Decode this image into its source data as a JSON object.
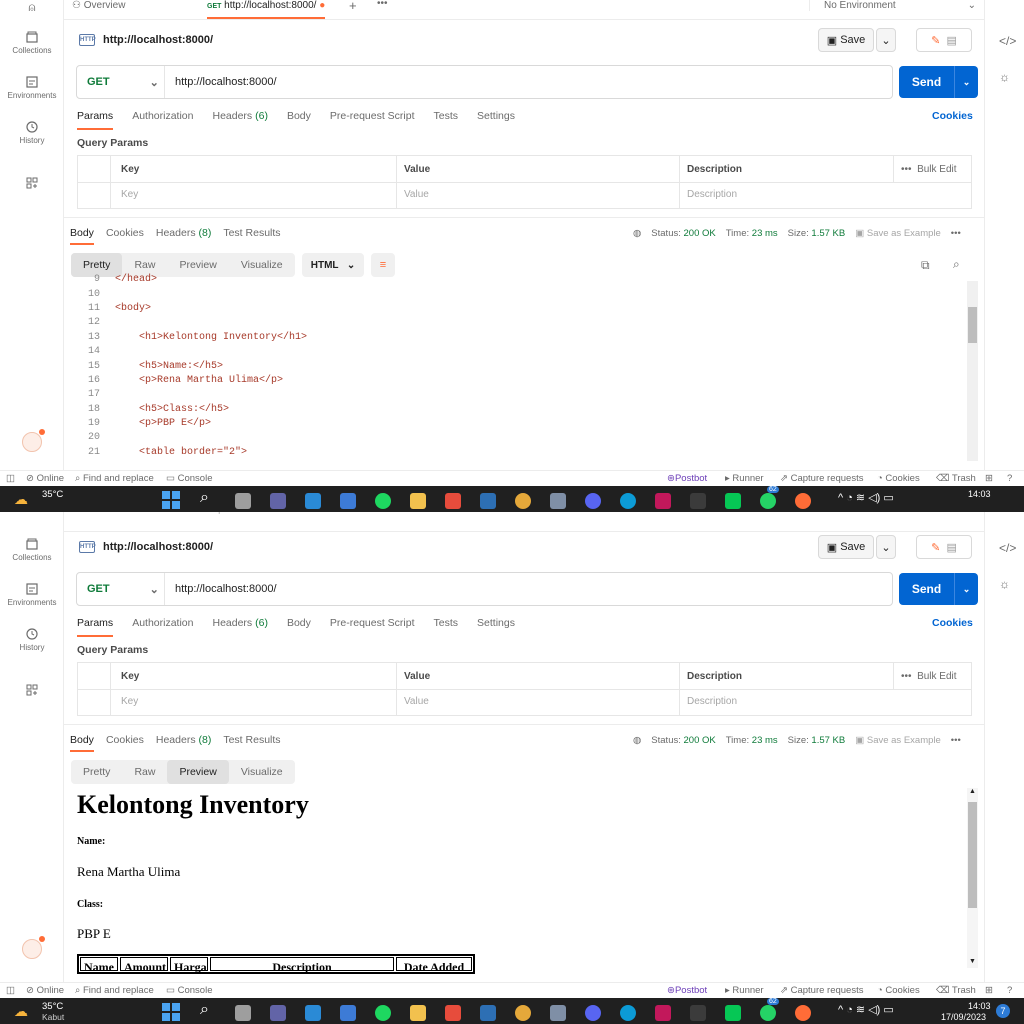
{
  "sidebar": {
    "items": [
      {
        "label": "Collections",
        "icon": "collections-icon"
      },
      {
        "label": "Environments",
        "icon": "environments-icon"
      },
      {
        "label": "History",
        "icon": "history-icon"
      },
      {
        "label": "",
        "icon": "apps-icon"
      }
    ]
  },
  "tabs_bar": {
    "overview": "Overview",
    "tab_method": "GET",
    "tab_url": "http://localhost:8000/",
    "environment": "No Environment"
  },
  "request": {
    "title": "http://localhost:8000/",
    "method": "GET",
    "url": "http://localhost:8000/",
    "save_label": "Save",
    "send_label": "Send"
  },
  "request_tabs": {
    "items": [
      "Params",
      "Authorization",
      "Headers",
      "Body",
      "Pre-request Script",
      "Tests",
      "Settings"
    ],
    "headers_count": "(6)",
    "cookies": "Cookies"
  },
  "query_params": {
    "label": "Query Params",
    "columns": [
      "Key",
      "Value",
      "Description"
    ],
    "placeholders": [
      "Key",
      "Value",
      "Description"
    ],
    "bulk_edit": "Bulk Edit"
  },
  "response": {
    "tabs": [
      "Body",
      "Cookies",
      "Headers",
      "Test Results"
    ],
    "headers_count": "(8)",
    "status_label": "Status:",
    "status_value": "200 OK",
    "time_label": "Time:",
    "time_value": "23 ms",
    "size_label": "Size:",
    "size_value": "1.57 KB",
    "save_example": "Save as Example",
    "view_modes": [
      "Pretty",
      "Raw",
      "Preview",
      "Visualize"
    ],
    "format": "HTML"
  },
  "code_lines": [
    {
      "n": "9",
      "text": "</head>"
    },
    {
      "n": "10",
      "text": ""
    },
    {
      "n": "11",
      "text": "<body>"
    },
    {
      "n": "12",
      "text": ""
    },
    {
      "n": "13",
      "text": "    <h1>Kelontong Inventory</h1>"
    },
    {
      "n": "14",
      "text": ""
    },
    {
      "n": "15",
      "text": "    <h5>Name:</h5>"
    },
    {
      "n": "16",
      "text": "    <p>Rena Martha Ulima</p>"
    },
    {
      "n": "17",
      "text": ""
    },
    {
      "n": "18",
      "text": "    <h5>Class:</h5>"
    },
    {
      "n": "19",
      "text": "    <p>PBP E</p>"
    },
    {
      "n": "20",
      "text": ""
    },
    {
      "n": "21",
      "text": "    <table border=\"2\">"
    }
  ],
  "preview": {
    "h1": "Kelontong Inventory",
    "name_label": "Name:",
    "name_value": "Rena Martha Ulima",
    "class_label": "Class:",
    "class_value": "PBP E",
    "table_headers": [
      "Name",
      "Amount",
      "Harga",
      "Description",
      "Date Added"
    ]
  },
  "statusbar": {
    "online": "Online",
    "find_replace": "Find and replace",
    "console": "Console",
    "postbot": "Postbot",
    "runner": "Runner",
    "capture": "Capture requests",
    "cookies": "Cookies",
    "trash": "Trash"
  },
  "taskbar": {
    "temp": "35°C",
    "weather": "Kabut",
    "time": "14:03",
    "date": "17/09/2023",
    "badge": "62",
    "notif": "7"
  },
  "colors": {
    "accent": "#ff6c37",
    "send": "#0265d2",
    "ok": "#0f7b3a"
  }
}
